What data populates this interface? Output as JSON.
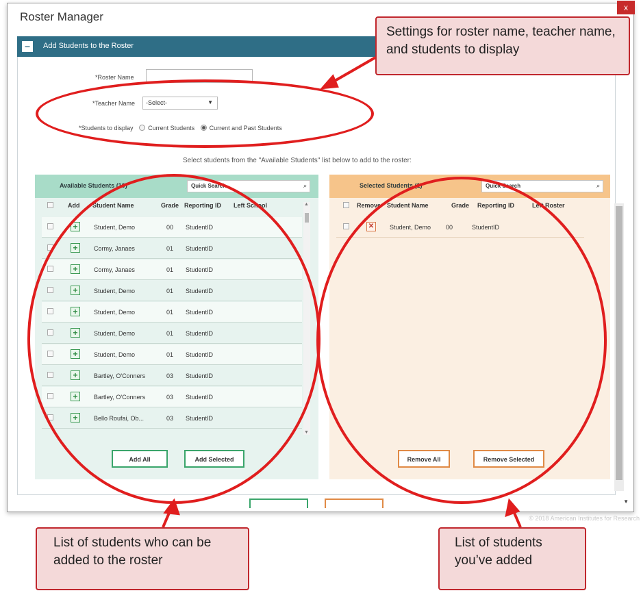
{
  "dialog": {
    "title": "Roster Manager",
    "close_label": "x",
    "panel_title": "Add Students to the Roster",
    "panel_toggle": "–"
  },
  "form": {
    "roster_name_label": "*Roster Name",
    "roster_name_value": "",
    "teacher_name_label": "*Teacher Name",
    "teacher_name_value": "-Select-",
    "students_display_label": "*Students to display",
    "option_current": "Current Students",
    "option_current_past": "Current and Past Students",
    "selected_option": "Current and Past Students"
  },
  "instructions": "Select students from the \"Available Students\" list below to add to the roster:",
  "available": {
    "title": "Available Students (10)",
    "search_placeholder": "Quick Search",
    "columns": [
      "Add",
      "Student Name",
      "Grade",
      "Reporting ID",
      "Left School"
    ],
    "rows": [
      {
        "name": "Student, Demo",
        "grade": "00",
        "id": "StudentID"
      },
      {
        "name": "Cormy, Janaes",
        "grade": "01",
        "id": "StudentID"
      },
      {
        "name": "Cormy, Janaes",
        "grade": "01",
        "id": "StudentID"
      },
      {
        "name": "Student, Demo",
        "grade": "01",
        "id": "StudentID"
      },
      {
        "name": "Student, Demo",
        "grade": "01",
        "id": "StudentID"
      },
      {
        "name": "Student, Demo",
        "grade": "01",
        "id": "StudentID"
      },
      {
        "name": "Student, Demo",
        "grade": "01",
        "id": "StudentID"
      },
      {
        "name": "Bartley, O'Conners",
        "grade": "03",
        "id": "StudentID"
      },
      {
        "name": "Bartley, O'Conners",
        "grade": "03",
        "id": "StudentID"
      },
      {
        "name": "Bello Roufai, Ob...",
        "grade": "03",
        "id": "StudentID"
      }
    ],
    "add_all_label": "Add All",
    "add_selected_label": "Add Selected"
  },
  "selected": {
    "title": "Selected Students (1)",
    "search_placeholder": "Quick Search",
    "columns": [
      "Remove",
      "Student Name",
      "Grade",
      "Reporting ID",
      "Left Roster"
    ],
    "rows": [
      {
        "name": "Student, Demo",
        "grade": "00",
        "id": "StudentID"
      }
    ],
    "remove_all_label": "Remove All",
    "remove_selected_label": "Remove Selected"
  },
  "footer": {
    "copyright": "© 2018 American Institutes for Research"
  },
  "callouts": {
    "settings": "Settings for roster name, teacher name, and students to display",
    "available": "List of students who can be added to the roster",
    "selected": "List of students you’ve added"
  },
  "colors": {
    "annotation_red": "#e01e1e",
    "panel_header": "#2f6e86",
    "available_header": "#a8dcc8",
    "selected_header": "#f6c48a"
  }
}
